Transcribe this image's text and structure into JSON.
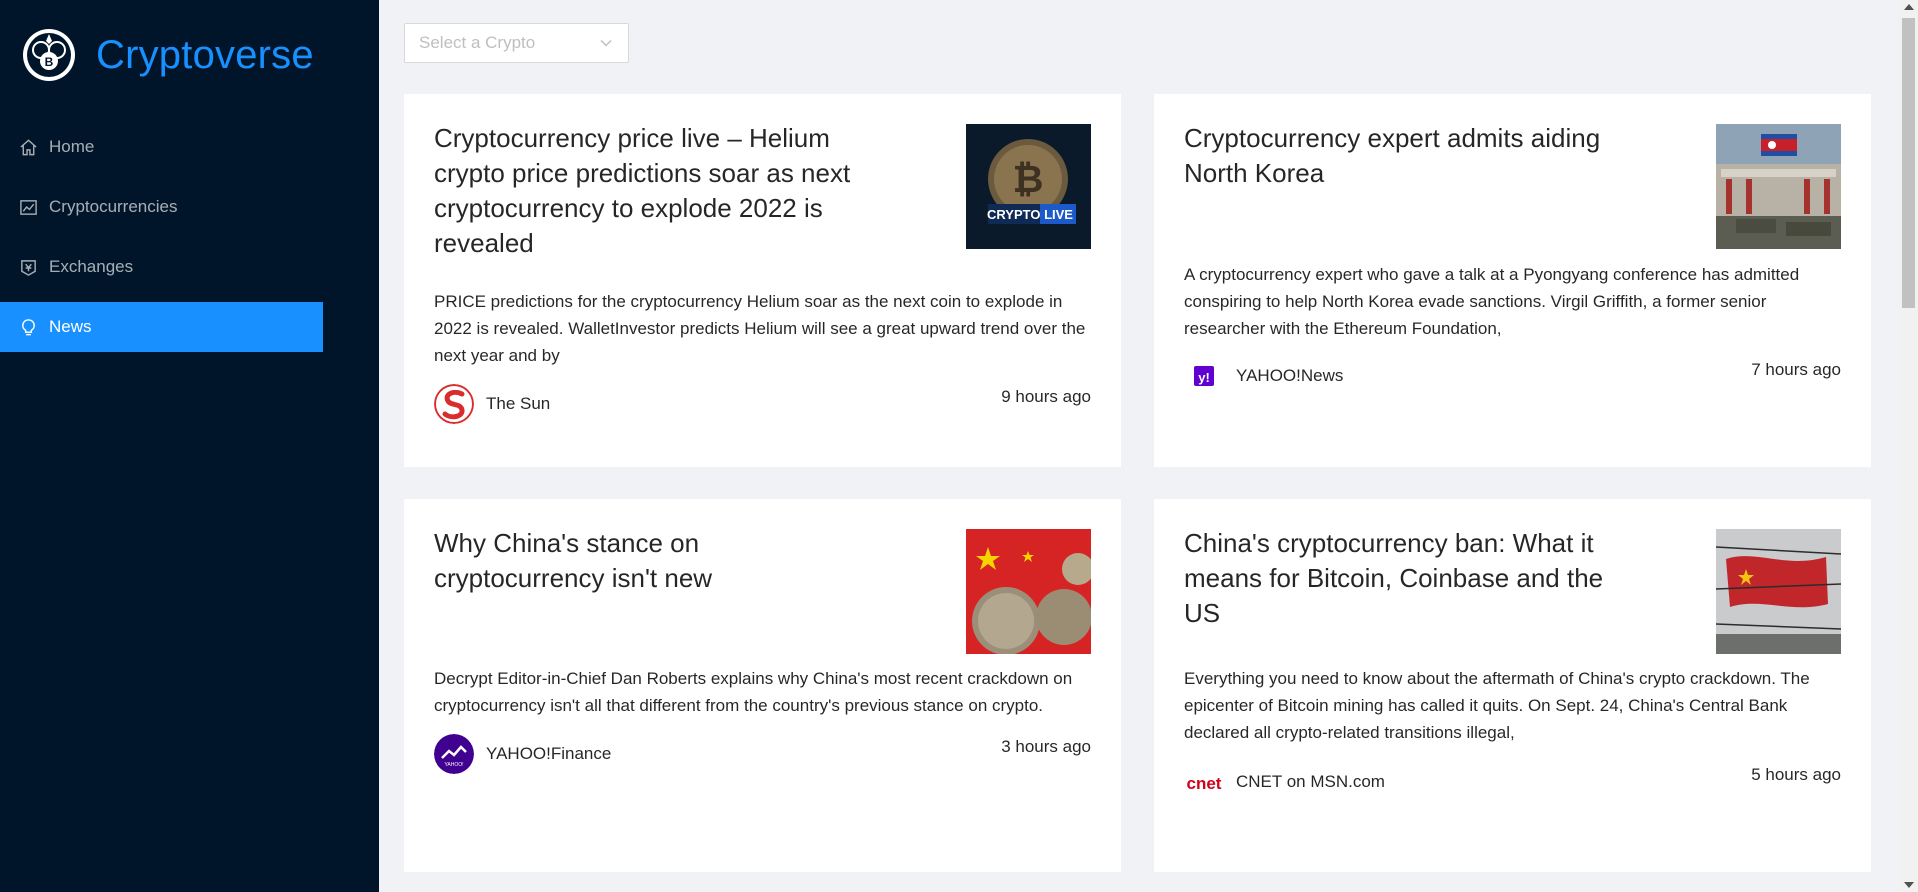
{
  "app": {
    "title": "Cryptoverse",
    "accent_color": "#1890ff",
    "sidebar_bg": "#001529"
  },
  "sidebar": {
    "items": [
      {
        "label": "Home",
        "icon": "home-icon",
        "active": false
      },
      {
        "label": "Cryptocurrencies",
        "icon": "line-chart-icon",
        "active": false
      },
      {
        "label": "Exchanges",
        "icon": "money-collect-icon",
        "active": false
      },
      {
        "label": "News",
        "icon": "bulb-icon",
        "active": true
      }
    ]
  },
  "filter": {
    "placeholder": "Select a Crypto"
  },
  "news": [
    {
      "title": "Cryptocurrency price live – Helium crypto price predictions soar as next cryptocurrency to explode 2022 is revealed",
      "description": "PRICE predictions for the cryptocurrency Helium soar as the next coin to explode in 2022 is revealed. WalletInvestor predicts Helium will see a great upward trend over the next year and by",
      "provider": "The Sun",
      "time": "9 hours ago",
      "image_text": "CRYPTO LIVE"
    },
    {
      "title": "Cryptocurrency expert admits aiding North Korea",
      "description": "A cryptocurrency expert who gave a talk at a Pyongyang conference has admitted conspiring to help North Korea evade sanctions. Virgil Griffith, a former senior researcher with the Ethereum Foundation,",
      "provider": "YAHOO!News",
      "time": "7 hours ago"
    },
    {
      "title": "Why China's stance on cryptocurrency isn't new",
      "description": "Decrypt Editor-in-Chief Dan Roberts explains why China's most recent crackdown on cryptocurrency isn't all that different from the country's previous stance on crypto.",
      "provider": "YAHOO!Finance",
      "time": "3 hours ago"
    },
    {
      "title": "China's cryptocurrency ban: What it means for Bitcoin, Coinbase and the US",
      "description": "Everything you need to know about the aftermath of China's crypto crackdown. The epicenter of Bitcoin mining has called it quits. On Sept. 24, China's Central Bank declared all crypto-related transitions illegal,",
      "provider": "CNET on MSN.com",
      "time": "5 hours ago",
      "provider_logo_text": "cnet"
    }
  ]
}
